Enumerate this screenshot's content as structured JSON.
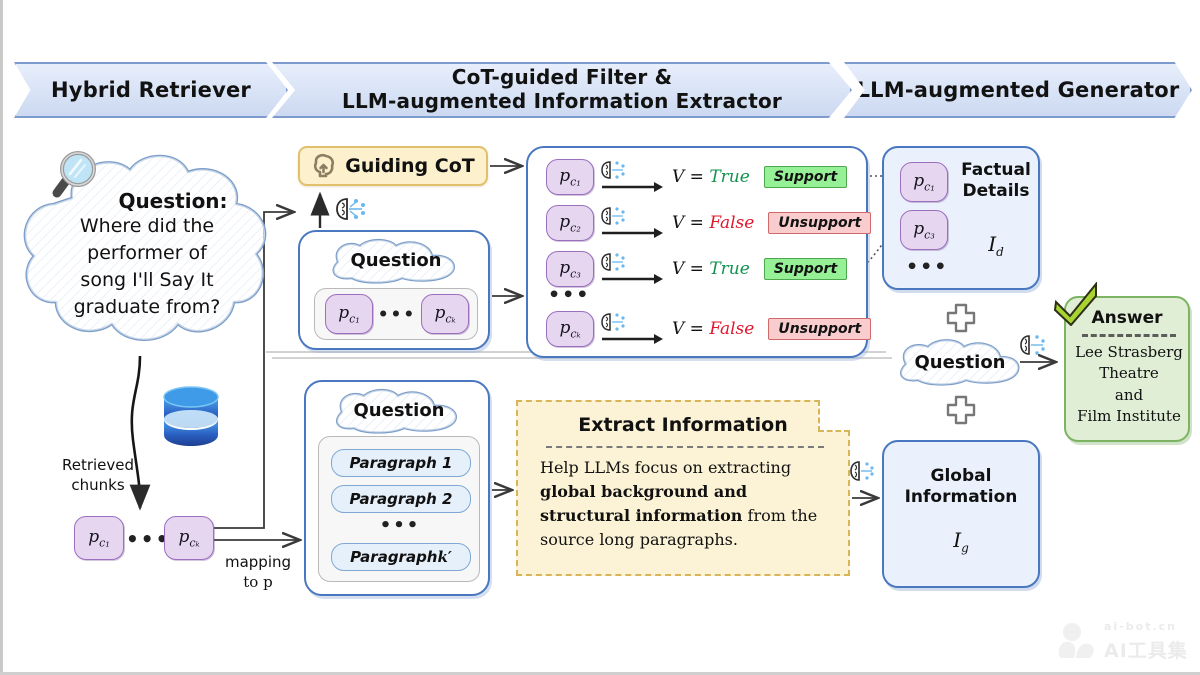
{
  "banners": [
    {
      "line1": "Hybrid Retriever",
      "line2": ""
    },
    {
      "line1": "CoT-guided Filter &",
      "line2": "LLM-augmented Information Extractor"
    },
    {
      "line1": "LLM-augmented Generator",
      "line2": ""
    }
  ],
  "question_cloud": {
    "heading": "Question:",
    "lines": [
      "Where did the",
      "performer of",
      "song I'll Say It",
      "graduate from?"
    ]
  },
  "retriever": {
    "retrieved_label_line1": "Retrieved",
    "retrieved_label_line2": "chunks",
    "mapping_label_line1": "mapping",
    "mapping_label_line2": "to p",
    "chunk_first": "p",
    "chunk_first_sub": "c₁",
    "chunk_last": "p",
    "chunk_last_sub": "cₖ",
    "ellipsis": "•••",
    "database_icon": "database-icon",
    "magnifier_icon": "magnifying-glass-icon"
  },
  "guiding_cot": {
    "label": "Guiding CoT",
    "icon": "head-thought-icon"
  },
  "question_chunks_panel": {
    "cloud_label": "Question",
    "chunk_first": "p",
    "chunk_first_sub": "c₁",
    "chunk_last": "p",
    "chunk_last_sub": "cₖ",
    "ellipsis": "•••"
  },
  "verification": {
    "ellipsis": "•••",
    "rows": [
      {
        "chunk": "p",
        "chunk_sub": "c₁",
        "expr_left": "V =",
        "verdict": "True",
        "verdict_kind": "true",
        "badge": "Support",
        "badge_kind": "support"
      },
      {
        "chunk": "p",
        "chunk_sub": "c₂",
        "expr_left": "V =",
        "verdict": "False",
        "verdict_kind": "false",
        "badge": "Unsupport",
        "badge_kind": "unsupport"
      },
      {
        "chunk": "p",
        "chunk_sub": "c₃",
        "expr_left": "V =",
        "verdict": "True",
        "verdict_kind": "true",
        "badge": "Support",
        "badge_kind": "support"
      },
      {
        "chunk": "p",
        "chunk_sub": "cₖ",
        "expr_left": "V =",
        "verdict": "False",
        "verdict_kind": "false",
        "badge": "Unsupport",
        "badge_kind": "unsupport"
      }
    ]
  },
  "factual_details": {
    "title_line1": "Factual",
    "title_line2": "Details",
    "symbol": "I",
    "symbol_sub": "d",
    "chunk_a": "p",
    "chunk_a_sub": "c₁",
    "chunk_b": "p",
    "chunk_b_sub": "c₃",
    "ellipsis": "•••"
  },
  "paragraph_panel": {
    "cloud_label": "Question",
    "paragraphs": [
      {
        "label": "Paragraph 1",
        "math": ""
      },
      {
        "label": "Paragraph 2",
        "math": ""
      },
      {
        "label": "Paragraph ",
        "math": "k′"
      }
    ],
    "ellipsis": "•••"
  },
  "extract_prompt": {
    "title": "Extract Information",
    "body_before": "Help LLMs focus on extracting ",
    "body_bold": "global background and structural information",
    "body_after": " from the source long paragraphs."
  },
  "global_information": {
    "title_line1": "Global",
    "title_line2": "Information",
    "symbol": "I",
    "symbol_sub": "g"
  },
  "generator": {
    "plus": "+",
    "question_label": "Question"
  },
  "answer": {
    "title": "Answer",
    "lines": [
      "Lee Strasberg",
      "Theatre",
      "and",
      "Film Institute"
    ],
    "check_icon": "check-mark-icon"
  },
  "watermark": {
    "line1": "ai-bot.cn",
    "line2": "AI工具集"
  },
  "colors": {
    "banner_border": "#7e9bcd",
    "panel_border": "#4a78c0",
    "panel_fill": "#eaf1fc",
    "chunk_fill": "#e6d6f0",
    "chunk_border": "#9b6fbe",
    "support_fill": "#96f096",
    "support_border": "#4ea64e",
    "unsupport_fill": "#f9cdcd",
    "unsupport_border": "#d06a6a",
    "cot_fill": "#fdf0cd",
    "cot_border": "#e2bf6d",
    "prompt_fill": "#fcf3d6",
    "prompt_border": "#d8b559",
    "answer_fill": "#dfeed5",
    "answer_border": "#7db463",
    "true_text": "#13924f",
    "false_text": "#e0182d"
  }
}
